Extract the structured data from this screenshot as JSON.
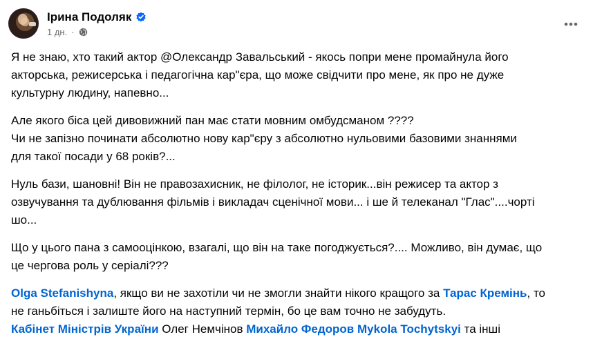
{
  "post": {
    "author": "Ірина Подоляк",
    "timestamp": "1 дн.",
    "separator": "·",
    "icons": {
      "verified": "verified-badge-icon",
      "audience": "globe-icon",
      "more": "more-options-icon"
    },
    "colors": {
      "link": "#0064d1",
      "verified": "#0866ff",
      "meta": "#65676b"
    },
    "paragraphs": [
      [
        "Я не знаю, хто такий актор @Олександр Завальський - якось попри мене промайнула його",
        "акторська, режисерська і педагогічна кар\"єра, що може свідчити про мене, як про не дуже",
        "культурну людину, напевно..."
      ],
      [
        "Але якого біса цей дивовижний пан має стати мовним омбудсманом ????",
        "Чи не запізно починати абсолютно нову кар\"єру з абсолютно нульовими базовими знаннями",
        "для такої посади у 68 років?..."
      ],
      [
        "Нуль бази, шановні! Він не правозахисник, не філолог, не історик...він режисер та актор з",
        "озвучування та дублювання фільмів і викладач сценічної мови... і ше й телеканал \"Глас\"....чорті",
        "шо..."
      ],
      [
        "Що у цього пана з самооцінкою, взагалі, що він на таке погоджується?.... Можливо, він думає, що",
        "це чергова роль у серіалі???"
      ]
    ],
    "final": {
      "line1": {
        "mention1": "Olga Stefanishyna",
        "text1": ", якщо ви не захотіли чи не змогли знайти нікого кращого за ",
        "mention2": "Тарас Кремінь",
        "text2": ", то"
      },
      "line2": "не ганьбіться і залиште його на наступний термін, бо це вам точно не забудуть.",
      "line3": {
        "mention1": "Кабінет Міністрів України",
        "text1": " Олег Немчінов ",
        "mention2": "Михайло Федоров",
        "text2": " ",
        "mention3": "Mykola Tochytskyi",
        "text3": " та інші"
      }
    }
  }
}
